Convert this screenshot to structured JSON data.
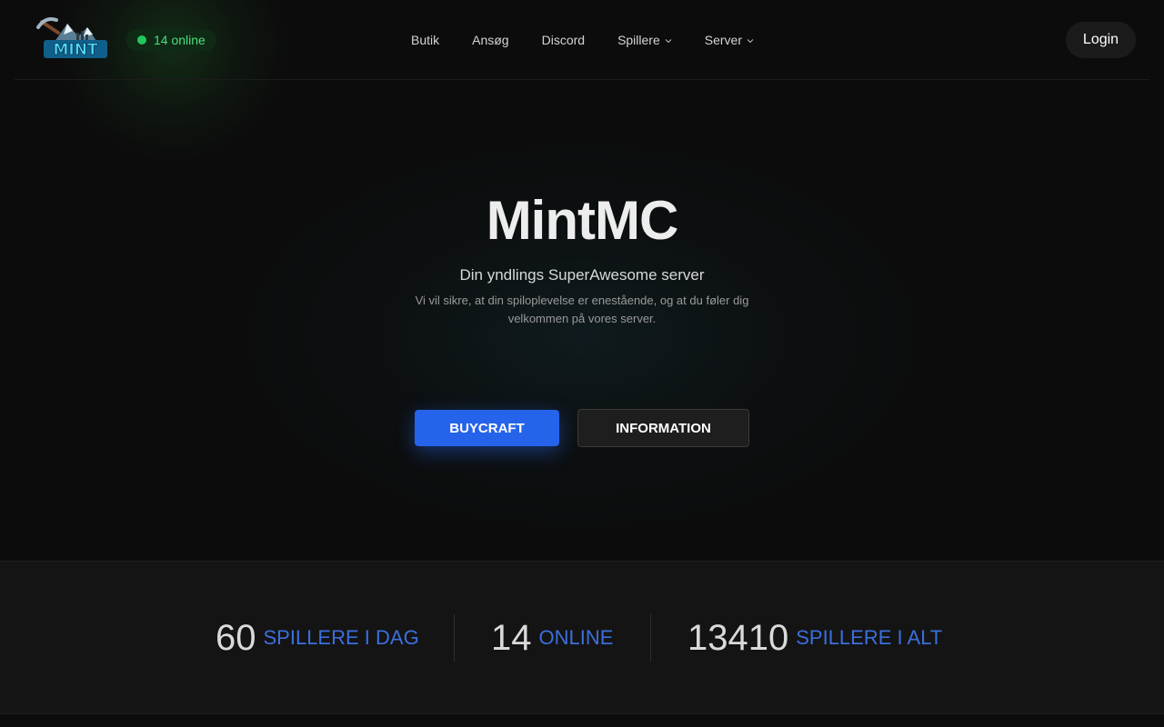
{
  "header": {
    "logo_text": "MINT",
    "online_badge": "14 online",
    "nav": [
      {
        "label": "Butik",
        "has_dropdown": false
      },
      {
        "label": "Ansøg",
        "has_dropdown": false
      },
      {
        "label": "Discord",
        "has_dropdown": false
      },
      {
        "label": "Spillere",
        "has_dropdown": true
      },
      {
        "label": "Server",
        "has_dropdown": true
      }
    ],
    "login_label": "Login"
  },
  "hero": {
    "title": "MintMC",
    "subtitle": "Din yndlings SuperAwesome server",
    "description": "Vi vil sikre, at din spiloplevelse er enestående, og at du føler dig velkommen på vores server.",
    "buycraft_label": "BUYCRAFT",
    "info_label": "INFORMATION"
  },
  "stats": [
    {
      "value": "60",
      "label": "Spillere i dag"
    },
    {
      "value": "14",
      "label": "Online"
    },
    {
      "value": "13410",
      "label": "Spillere i alt"
    }
  ],
  "colors": {
    "accent": "#2563eb",
    "online_green": "#22c55e",
    "stat_label": "#3b6fdc",
    "background": "#0c0c0c"
  },
  "icons": [
    "mint-logo",
    "online-dot-icon",
    "chevron-down-icon"
  ]
}
